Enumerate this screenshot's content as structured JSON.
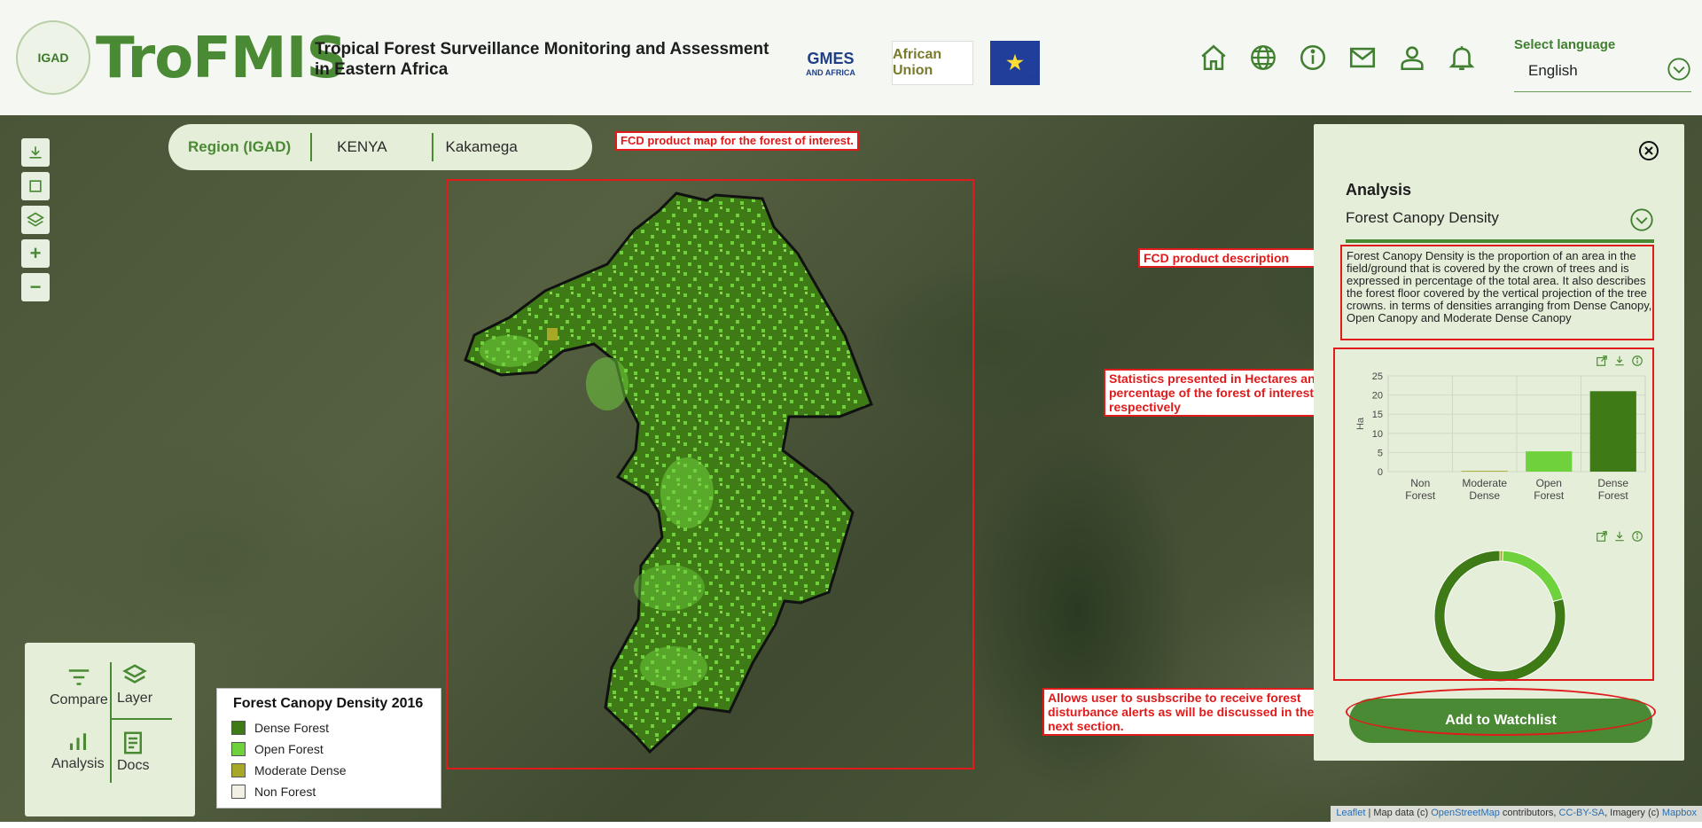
{
  "header": {
    "logo_text": "IGAD",
    "brand": "TroFMIS",
    "subtitle_line1": "Tropical Forest Surveillance Monitoring and Assessment",
    "subtitle_line2": "in Eastern Africa",
    "partners": {
      "gmes": "GMES",
      "gmes_sub": "AND AFRICA",
      "au": "African Union",
      "eu_label": "European Union"
    },
    "nav_icons": [
      "home-icon",
      "globe-icon",
      "info-icon",
      "mail-icon",
      "user-icon",
      "bell-icon"
    ],
    "language": {
      "label": "Select language",
      "value": "English"
    }
  },
  "map": {
    "breadcrumb": [
      "Region (IGAD)",
      "KENYA",
      "Kakamega"
    ],
    "controls": [
      "download-icon",
      "draw-rectangle-icon",
      "layers-icon",
      "zoom-in-icon",
      "zoom-out-icon"
    ],
    "annotations": {
      "fcd_map": "FCD product map for the forest of interest.",
      "fcd_desc": "FCD product description",
      "stats": "Statistics presented in Hectares and percentage of the forest of interest respectively",
      "watchlist": "Allows user to susbscribe to receive forest disturbance alerts as will be discussed in the next section."
    },
    "legend": {
      "title": "Forest Canopy Density 2016",
      "items": [
        {
          "label": "Dense Forest",
          "color": "#3e7a16"
        },
        {
          "label": "Open Forest",
          "color": "#6fd13c"
        },
        {
          "label": "Moderate Dense",
          "color": "#a8a828"
        },
        {
          "label": "Non Forest",
          "color": "#f2f0e4"
        }
      ]
    },
    "toolbox": {
      "compare": "Compare",
      "layer": "Layer",
      "analysis": "Analysis",
      "docs": "Docs"
    },
    "attribution": {
      "leaflet": "Leaflet",
      "text1": " | Map data (c) ",
      "osm": "OpenStreetMap",
      "text2": " contributors, ",
      "license": "CC-BY-SA",
      "text3": ", Imagery (c) ",
      "mapbox": "Mapbox"
    }
  },
  "panel": {
    "heading": "Analysis",
    "selected_analysis": "Forest Canopy Density",
    "description": "Forest Canopy Density is the proportion of an area in the field/ground that is covered by the crown of trees and is expressed in percentage of the total area. It also describes the forest floor covered by the vertical projection of the tree crowns. in terms of densities arranging from Dense Canopy, Open Canopy and Moderate Dense Canopy",
    "watchlist_button": "Add to Watchlist"
  },
  "chart_data": [
    {
      "type": "bar",
      "categories": [
        "Non Forest",
        "Moderate Dense",
        "Open Forest",
        "Dense Forest"
      ],
      "category_lines": [
        [
          "Non",
          "Forest"
        ],
        [
          "Moderate",
          "Dense"
        ],
        [
          "Open",
          "Forest"
        ],
        [
          "Dense",
          "Forest"
        ]
      ],
      "values": [
        0,
        0.2,
        5.3,
        21
      ],
      "colors": [
        "#f2f0e4",
        "#a8a828",
        "#6fd13c",
        "#3e7a16"
      ],
      "ylabel": "Ha",
      "ylim": [
        0,
        25
      ],
      "yticks": [
        0,
        5,
        10,
        15,
        20,
        25
      ],
      "grid": true
    },
    {
      "type": "pie",
      "donut": true,
      "categories": [
        "Non Forest",
        "Moderate Dense",
        "Open Forest",
        "Dense Forest"
      ],
      "values": [
        0,
        0.2,
        5.3,
        21
      ],
      "colors": [
        "#f2f0e4",
        "#a8a828",
        "#6fd13c",
        "#3e7a16"
      ]
    }
  ]
}
